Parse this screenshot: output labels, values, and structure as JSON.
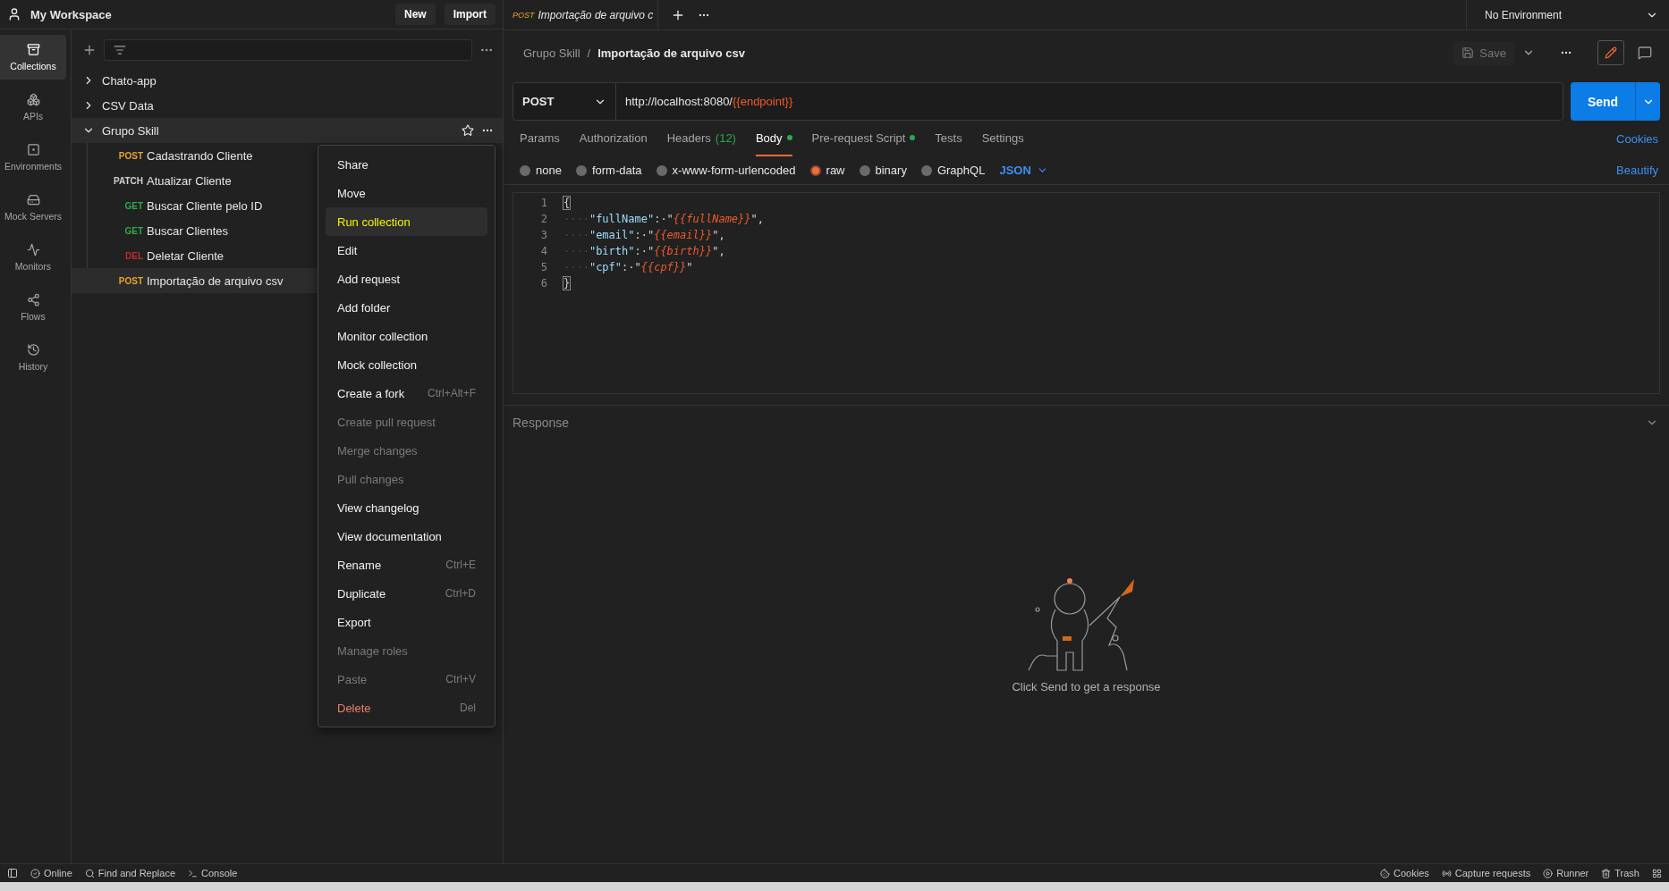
{
  "workspace": {
    "title": "My Workspace",
    "buttons": [
      "New",
      "Import"
    ]
  },
  "rail": [
    {
      "label": "Collections",
      "selected": true
    },
    {
      "label": "APIs",
      "selected": false
    },
    {
      "label": "Environments",
      "selected": false
    },
    {
      "label": "Mock Servers",
      "selected": false
    },
    {
      "label": "Monitors",
      "selected": false
    },
    {
      "label": "Flows",
      "selected": false
    },
    {
      "label": "History",
      "selected": false
    }
  ],
  "tree": [
    {
      "name": "Chato-app",
      "expanded": false
    },
    {
      "name": "CSV Data",
      "expanded": false
    },
    {
      "name": "Grupo Skill",
      "expanded": true,
      "children": [
        {
          "method": "POST",
          "name": "Cadastrando Cliente",
          "color": "#e8a22c",
          "selected": false
        },
        {
          "method": "PATCH",
          "name": "Atualizar Cliente",
          "color": "#d0d0d0",
          "selected": false
        },
        {
          "method": "GET",
          "name": "Buscar Cliente pelo ID",
          "color": "#2fa84f",
          "selected": false
        },
        {
          "method": "GET",
          "name": "Buscar Clientes",
          "color": "#2fa84f",
          "selected": false
        },
        {
          "method": "DEL",
          "name": "Deletar Cliente",
          "color": "#c22b2b",
          "selected": false
        },
        {
          "method": "POST",
          "name": "Importação de arquivo csv",
          "color": "#e8a22c",
          "selected": true
        }
      ]
    }
  ],
  "context_menu": [
    {
      "label": "Share",
      "kind": "normal",
      "selected": false
    },
    {
      "label": "Move",
      "kind": "normal",
      "selected": false
    },
    {
      "label": "Run collection",
      "kind": "normal",
      "selected": true
    },
    {
      "label": "Edit",
      "kind": "normal",
      "selected": false
    },
    {
      "label": "Add request",
      "kind": "normal",
      "selected": false
    },
    {
      "label": "Add folder",
      "kind": "normal",
      "selected": false
    },
    {
      "label": "Monitor collection",
      "kind": "normal",
      "selected": false
    },
    {
      "label": "Mock collection",
      "kind": "normal",
      "selected": false
    },
    {
      "label": "Create a fork",
      "shortcut": "Ctrl+Alt+F",
      "kind": "normal",
      "selected": false
    },
    {
      "label": "Create pull request",
      "kind": "disabled",
      "selected": false
    },
    {
      "label": "Merge changes",
      "kind": "disabled",
      "selected": false
    },
    {
      "label": "Pull changes",
      "kind": "disabled",
      "selected": false
    },
    {
      "label": "View changelog",
      "kind": "normal",
      "selected": false
    },
    {
      "label": "View documentation",
      "kind": "normal",
      "selected": false
    },
    {
      "label": "Rename",
      "shortcut": "Ctrl+E",
      "kind": "normal",
      "selected": false
    },
    {
      "label": "Duplicate",
      "shortcut": "Ctrl+D",
      "kind": "normal",
      "selected": false
    },
    {
      "label": "Export",
      "kind": "normal",
      "selected": false
    },
    {
      "label": "Manage roles",
      "kind": "disabled",
      "selected": false
    },
    {
      "label": "Paste",
      "shortcut": "Ctrl+V",
      "kind": "disabled",
      "selected": false
    },
    {
      "label": "Delete",
      "shortcut": "Del",
      "kind": "danger",
      "selected": false
    }
  ],
  "open_tab": {
    "method": "POST",
    "title": "Importação de arquivo c"
  },
  "environment": "No Environment",
  "breadcrumb": [
    "Grupo Skill",
    "Importação de arquivo csv"
  ],
  "breadcrumb_separator": "/",
  "save_label": "Save",
  "url": {
    "method": "POST",
    "parts": [
      {
        "text": "http://localhost:8080/",
        "kind": "plain"
      },
      {
        "text": "{{endpoint}}",
        "kind": "variable"
      }
    ]
  },
  "send_label": "Send",
  "request_tabs": [
    {
      "label": "Params",
      "selected": false,
      "dot": false
    },
    {
      "label": "Authorization",
      "selected": false,
      "dot": false
    },
    {
      "label": "Headers",
      "count": "(12)",
      "selected": false,
      "dot": false
    },
    {
      "label": "Body",
      "selected": true,
      "dot": true
    },
    {
      "label": "Pre-request Script",
      "selected": false,
      "dot": true
    },
    {
      "label": "Tests",
      "selected": false,
      "dot": false
    },
    {
      "label": "Settings",
      "selected": false,
      "dot": false
    }
  ],
  "cookies_link": "Cookies",
  "body_types": [
    {
      "label": "none",
      "selected": false
    },
    {
      "label": "form-data",
      "selected": false
    },
    {
      "label": "x-www-form-urlencoded",
      "selected": false
    },
    {
      "label": "raw",
      "selected": true
    },
    {
      "label": "binary",
      "selected": false
    },
    {
      "label": "GraphQL",
      "selected": false
    }
  ],
  "format": "JSON",
  "beautify_link": "Beautify",
  "code_lines": [
    {
      "number": "1",
      "tokens": [
        {
          "text": "{",
          "kind": "brace"
        }
      ]
    },
    {
      "number": "2",
      "tokens": [
        {
          "text": "····",
          "kind": "indent"
        },
        {
          "text": "\"fullName\"",
          "kind": "key"
        },
        {
          "text": ":·",
          "kind": "punct"
        },
        {
          "text": "\"",
          "kind": "string"
        },
        {
          "text": "{{fullName}}",
          "kind": "variable"
        },
        {
          "text": "\",",
          "kind": "string"
        }
      ]
    },
    {
      "number": "3",
      "tokens": [
        {
          "text": "····",
          "kind": "indent"
        },
        {
          "text": "\"email\"",
          "kind": "key"
        },
        {
          "text": ":·",
          "kind": "punct"
        },
        {
          "text": "\"",
          "kind": "string"
        },
        {
          "text": "{{email}}",
          "kind": "variable"
        },
        {
          "text": "\",",
          "kind": "string"
        }
      ]
    },
    {
      "number": "4",
      "tokens": [
        {
          "text": "····",
          "kind": "indent"
        },
        {
          "text": "\"birth\"",
          "kind": "key"
        },
        {
          "text": ":·",
          "kind": "punct"
        },
        {
          "text": "\"",
          "kind": "string"
        },
        {
          "text": "{{birth}}",
          "kind": "variable"
        },
        {
          "text": "\",",
          "kind": "string"
        }
      ]
    },
    {
      "number": "5",
      "tokens": [
        {
          "text": "····",
          "kind": "indent"
        },
        {
          "text": "\"cpf\"",
          "kind": "key"
        },
        {
          "text": ":·",
          "kind": "punct"
        },
        {
          "text": "\"",
          "kind": "string"
        },
        {
          "text": "{{cpf}}",
          "kind": "variable"
        },
        {
          "text": "\"",
          "kind": "string"
        }
      ]
    },
    {
      "number": "6",
      "tokens": [
        {
          "text": "}",
          "kind": "brace"
        }
      ]
    }
  ],
  "response": {
    "title": "Response",
    "message": "Click Send to get a response"
  },
  "status_left": [
    "Online",
    "Find and Replace",
    "Console"
  ],
  "status_right": [
    "Cookies",
    "Capture requests",
    "Runner",
    "Trash"
  ]
}
